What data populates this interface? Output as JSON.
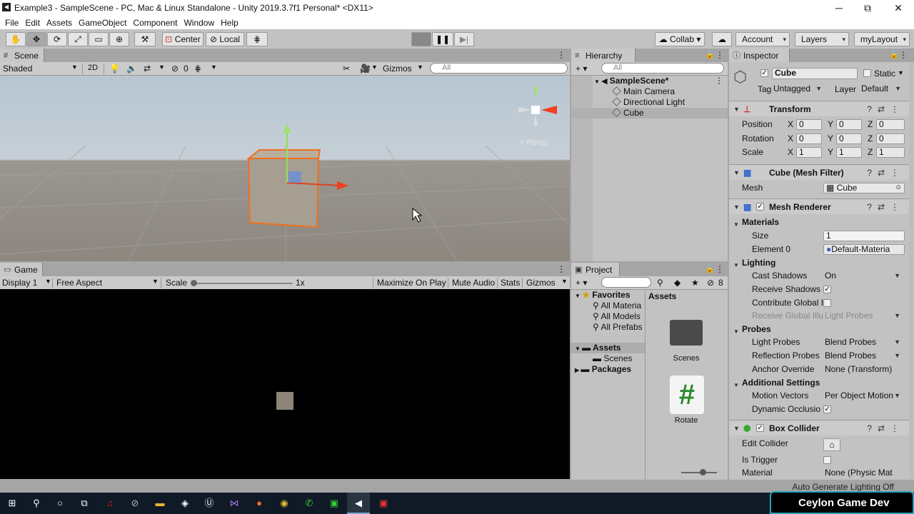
{
  "window": {
    "title": "Example3 - SampleScene - PC, Mac & Linux Standalone - Unity 2019.3.7f1 Personal* <DX11>",
    "min": "─",
    "max": "⧉",
    "close": "✕",
    "icon": "unity-icon"
  },
  "menu": [
    "File",
    "Edit",
    "Assets",
    "GameObject",
    "Component",
    "Window",
    "Help"
  ],
  "toolbar": {
    "center": "Center",
    "local": "Local",
    "collab": "Collab",
    "account": "Account",
    "layers": "Layers",
    "layout": "myLayout"
  },
  "scene": {
    "tab": "Scene",
    "shading": "Shaded",
    "mode2d": "2D",
    "gizmos": "Gizmos",
    "search": "All",
    "hidden_count": "0",
    "persp": "< Persp"
  },
  "game": {
    "tab": "Game",
    "display": "Display 1",
    "aspect": "Free Aspect",
    "scale_label": "Scale",
    "scale_value": "1x",
    "maximize": "Maximize On Play",
    "mute": "Mute Audio",
    "stats": "Stats",
    "gizmos": "Gizmos"
  },
  "hierarchy": {
    "tab": "Hierarchy",
    "search": "All",
    "scene": "SampleScene*",
    "items": [
      "Main Camera",
      "Directional Light",
      "Cube"
    ]
  },
  "project": {
    "tab": "Project",
    "favorites": "Favorites",
    "fav_items": [
      "All Materia",
      "All Models",
      "All Prefabs"
    ],
    "assets": "Assets",
    "asset_folders": [
      "Scenes"
    ],
    "packages": "Packages",
    "assets_header": "Assets",
    "grid": [
      {
        "name": "Scenes",
        "icon": "folder-icon"
      },
      {
        "name": "Rotate",
        "icon": "script-icon"
      }
    ],
    "hidden_count": "8"
  },
  "inspector": {
    "tab": "Inspector",
    "name": "Cube",
    "static": "Static",
    "tag_label": "Tag",
    "tag": "Untagged",
    "layer_label": "Layer",
    "layer": "Default",
    "transform": {
      "title": "Transform",
      "position_label": "Position",
      "rotation_label": "Rotation",
      "scale_label": "Scale",
      "position": [
        "0",
        "0",
        "0"
      ],
      "rotation": [
        "0",
        "0",
        "0"
      ],
      "scale": [
        "1",
        "1",
        "1"
      ]
    },
    "mesh_filter": {
      "title": "Cube (Mesh Filter)",
      "mesh_label": "Mesh",
      "mesh": "Cube"
    },
    "mesh_renderer": {
      "title": "Mesh Renderer",
      "materials": "Materials",
      "size_label": "Size",
      "size": "1",
      "element0_label": "Element 0",
      "element0": "Default-Materia",
      "lighting": "Lighting",
      "cast_shadows_label": "Cast Shadows",
      "cast_shadows": "On",
      "receive_shadows_label": "Receive Shadows",
      "contribute_gi_label": "Contribute Global I",
      "receive_gi_label": "Receive Global Illu",
      "receive_gi": "Light Probes",
      "probes": "Probes",
      "light_probes_label": "Light Probes",
      "light_probes": "Blend Probes",
      "reflection_probes_label": "Reflection Probes",
      "reflection_probes": "Blend Probes",
      "anchor_label": "Anchor Override",
      "anchor": "None (Transform)",
      "additional": "Additional Settings",
      "motion_label": "Motion Vectors",
      "motion": "Per Object Motion",
      "dynamic_label": "Dynamic Occlusio"
    },
    "box_collider": {
      "title": "Box Collider",
      "edit_label": "Edit Collider",
      "trigger_label": "Is Trigger",
      "material_label": "Material",
      "material": "None (Physic Mat"
    }
  },
  "statusbar": {
    "text": "Auto Generate Lighting Off"
  },
  "overlay": {
    "channel": "Ceylon Game Dev"
  }
}
